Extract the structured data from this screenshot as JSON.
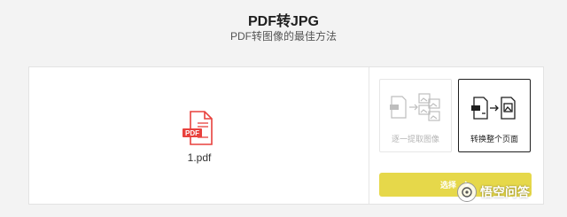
{
  "header": {
    "title": "PDF转JPG",
    "subtitle": "PDF转图像的最佳方法"
  },
  "file": {
    "name": "1.pdf",
    "badge": "PDF",
    "icon": "pdf-file-icon",
    "color": "#e8413d"
  },
  "options": [
    {
      "label": "逐一提取图像",
      "icon": "extract-images-icon",
      "selected": false
    },
    {
      "label": "转换整个页面",
      "icon": "convert-page-icon",
      "selected": true
    }
  ],
  "select_button": {
    "label": "选择",
    "icon": "chevron-right-icon",
    "color": "#e6d84a"
  },
  "watermark": {
    "text": "悟空问答"
  }
}
